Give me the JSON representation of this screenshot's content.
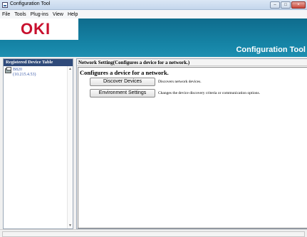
{
  "window": {
    "title": "Configuration Tool"
  },
  "menu": [
    "File",
    "Tools",
    "Plug-ins",
    "View",
    "Help"
  ],
  "banner": {
    "logo": "OKI",
    "title": "Configuration Tool",
    "logo_color": "#c8102e",
    "bar_color": "#1685a7"
  },
  "left_panel": {
    "header": "Registered Device Table",
    "devices": [
      {
        "name": "B820",
        "ip": "(10.215.4.53)"
      }
    ]
  },
  "right_panel": {
    "header": "Network Setting(Configures a device for a network.)",
    "section_title": "Configures a device for a network.",
    "actions": [
      {
        "label": "Discover Devices",
        "description": "Discovers network devices."
      },
      {
        "label": "Environment Settings",
        "description": "Changes the device discovery criteria or communication options."
      }
    ]
  },
  "status": {
    "text": ""
  }
}
